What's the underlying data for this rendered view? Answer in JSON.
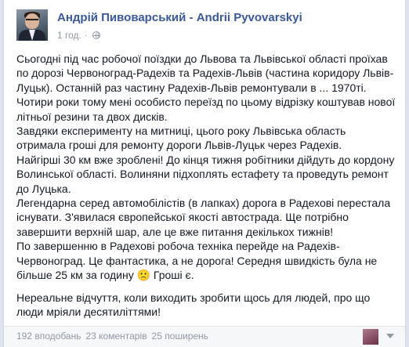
{
  "post": {
    "author": "Андрій Пивоварський - Andrii Pyvovarskyi",
    "time": "1 год.",
    "separator": "·",
    "privacy_icon": "globe-icon",
    "paragraphs": [
      "Сьогодні під час робочої поїздки до Львова та Львівської області проїхав по дорозі Червоноград-Радехів та Радехів-Львів (частина коридору Львів-Луцьк). Останній раз частину Радехів-Львів ремонтували в ... 1970ті. Чотири роки тому мені особисто переїзд по цьому відрізку коштував нової літньої резини та двох дисків.",
      "Завдяки експерименту на митниці, цього року Львівська область отримала гроші для ремонту дороги Львів-Луцьк через Радехів.",
      "Найгірші 30 км вже зроблені! До кінця тижня робітники дійдуть до кордону Волинської області. Волиняни підхоплять естафету та проведуть ремонт до Луцька.",
      "Легендарна серед автомобілістів (в лапках) дорога в Радехові перестала існувати. З'явилася європейської якості автострада. Ще потрібно завершити верхній шар, але це вже питання декількох тижнів!",
      "По завершенню в Радехові робоча техніка перейде на Радехів-Червоноград. Це фантастика, а не дорога! Середня швидкість була не більше 25 км за годину 🙁 Гроші є.",
      "Нереальне відчуття, коли виходить зробити щось для людей, про що люди мріяли десятиліттями!"
    ]
  },
  "footer": {
    "likes": "192 вподобань",
    "comments": "23 коментарів",
    "shares": "25 поширень"
  }
}
